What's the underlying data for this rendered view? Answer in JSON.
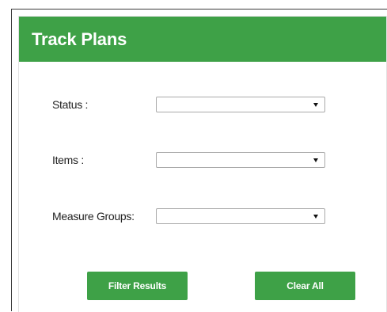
{
  "panel": {
    "title": "Track Plans"
  },
  "filters": [
    {
      "label": "Status :",
      "selected": ""
    },
    {
      "label": "Items :",
      "selected": ""
    },
    {
      "label": "Measure Groups:",
      "selected": ""
    }
  ],
  "buttons": {
    "filter_label": "Filter Results",
    "clear_label": "Clear All"
  },
  "colors": {
    "accent": "#3ea147",
    "header_text": "#ffffff"
  }
}
